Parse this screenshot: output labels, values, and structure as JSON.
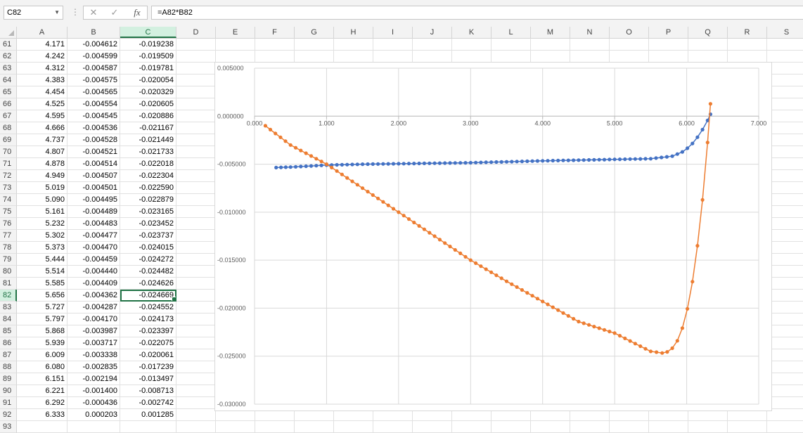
{
  "formula_bar": {
    "name_box": "C82",
    "formula": "=A82*B82",
    "fx_label": "fx",
    "cancel_glyph": "✕",
    "enter_glyph": "✓",
    "dropdown_icon": "chevron-down-icon"
  },
  "columns": [
    "A",
    "B",
    "C",
    "D",
    "E",
    "F",
    "G",
    "H",
    "I",
    "J",
    "K",
    "L",
    "M",
    "N",
    "O",
    "P",
    "Q",
    "R",
    "S"
  ],
  "selected_column": "C",
  "selected_row": "82",
  "rows": [
    {
      "num": "61",
      "a": "4.171",
      "b": "-0.004612",
      "c": "-0.019238"
    },
    {
      "num": "62",
      "a": "4.242",
      "b": "-0.004599",
      "c": "-0.019509"
    },
    {
      "num": "63",
      "a": "4.312",
      "b": "-0.004587",
      "c": "-0.019781"
    },
    {
      "num": "64",
      "a": "4.383",
      "b": "-0.004575",
      "c": "-0.020054"
    },
    {
      "num": "65",
      "a": "4.454",
      "b": "-0.004565",
      "c": "-0.020329"
    },
    {
      "num": "66",
      "a": "4.525",
      "b": "-0.004554",
      "c": "-0.020605"
    },
    {
      "num": "67",
      "a": "4.595",
      "b": "-0.004545",
      "c": "-0.020886"
    },
    {
      "num": "68",
      "a": "4.666",
      "b": "-0.004536",
      "c": "-0.021167"
    },
    {
      "num": "69",
      "a": "4.737",
      "b": "-0.004528",
      "c": "-0.021449"
    },
    {
      "num": "70",
      "a": "4.807",
      "b": "-0.004521",
      "c": "-0.021733"
    },
    {
      "num": "71",
      "a": "4.878",
      "b": "-0.004514",
      "c": "-0.022018"
    },
    {
      "num": "72",
      "a": "4.949",
      "b": "-0.004507",
      "c": "-0.022304"
    },
    {
      "num": "73",
      "a": "5.019",
      "b": "-0.004501",
      "c": "-0.022590"
    },
    {
      "num": "74",
      "a": "5.090",
      "b": "-0.004495",
      "c": "-0.022879"
    },
    {
      "num": "75",
      "a": "5.161",
      "b": "-0.004489",
      "c": "-0.023165"
    },
    {
      "num": "76",
      "a": "5.232",
      "b": "-0.004483",
      "c": "-0.023452"
    },
    {
      "num": "77",
      "a": "5.302",
      "b": "-0.004477",
      "c": "-0.023737"
    },
    {
      "num": "78",
      "a": "5.373",
      "b": "-0.004470",
      "c": "-0.024015"
    },
    {
      "num": "79",
      "a": "5.444",
      "b": "-0.004459",
      "c": "-0.024272"
    },
    {
      "num": "80",
      "a": "5.514",
      "b": "-0.004440",
      "c": "-0.024482"
    },
    {
      "num": "81",
      "a": "5.585",
      "b": "-0.004409",
      "c": "-0.024626"
    },
    {
      "num": "82",
      "a": "5.656",
      "b": "-0.004362",
      "c": "-0.024669"
    },
    {
      "num": "83",
      "a": "5.727",
      "b": "-0.004287",
      "c": "-0.024552"
    },
    {
      "num": "84",
      "a": "5.797",
      "b": "-0.004170",
      "c": "-0.024173"
    },
    {
      "num": "85",
      "a": "5.868",
      "b": "-0.003987",
      "c": "-0.023397"
    },
    {
      "num": "86",
      "a": "5.939",
      "b": "-0.003717",
      "c": "-0.022075"
    },
    {
      "num": "87",
      "a": "6.009",
      "b": "-0.003338",
      "c": "-0.020061"
    },
    {
      "num": "88",
      "a": "6.080",
      "b": "-0.002835",
      "c": "-0.017239"
    },
    {
      "num": "89",
      "a": "6.151",
      "b": "-0.002194",
      "c": "-0.013497"
    },
    {
      "num": "90",
      "a": "6.221",
      "b": "-0.001400",
      "c": "-0.008713"
    },
    {
      "num": "91",
      "a": "6.292",
      "b": "-0.000436",
      "c": "-0.002742"
    },
    {
      "num": "92",
      "a": "6.333",
      "b": "0.000203",
      "c": "0.001285"
    },
    {
      "num": "93",
      "a": "",
      "b": "",
      "c": ""
    }
  ],
  "chart_data": {
    "type": "scatter",
    "y_tick_labels": [
      "0.005000",
      "0.000000",
      "-0.005000",
      "-0.010000",
      "-0.015000",
      "-0.020000",
      "-0.025000",
      "-0.030000"
    ],
    "x_tick_labels": [
      "0.000",
      "1.000",
      "2.000",
      "3.000",
      "4.000",
      "5.000",
      "6.000",
      "7.000"
    ],
    "xlim": [
      0,
      7
    ],
    "ylim": [
      -0.03,
      0.005
    ],
    "grid": true,
    "legend": "none",
    "series": [
      {
        "color": "#4472c4",
        "x": [
          0.3,
          0.5,
          1.0,
          1.5,
          2.0,
          2.5,
          3.0,
          3.5,
          4.0,
          4.5,
          5.0,
          5.5,
          5.8,
          5.94,
          6.01,
          6.08,
          6.15,
          6.22,
          6.29,
          6.33
        ],
        "y": [
          -0.00535,
          -0.0053,
          -0.0051,
          -0.005,
          -0.00495,
          -0.0049,
          -0.00485,
          -0.00475,
          -0.00465,
          -0.00458,
          -0.0045,
          -0.00443,
          -0.00417,
          -0.00372,
          -0.00334,
          -0.00284,
          -0.00219,
          -0.0014,
          -0.00044,
          0.000203
        ]
      },
      {
        "color": "#ed7d31",
        "x": [
          0.15,
          0.5,
          1.0,
          1.5,
          2.0,
          2.5,
          3.0,
          3.5,
          4.0,
          4.5,
          5.0,
          5.5,
          5.66,
          5.73,
          5.8,
          5.87,
          5.94,
          6.01,
          6.08,
          6.15,
          6.22,
          6.29,
          6.33
        ],
        "y": [
          -0.001,
          -0.003,
          -0.005,
          -0.0075,
          -0.01,
          -0.0125,
          -0.015,
          -0.0172,
          -0.0193,
          -0.0214,
          -0.0226,
          -0.0245,
          -0.024669,
          -0.024552,
          -0.024173,
          -0.023397,
          -0.022075,
          -0.020061,
          -0.017239,
          -0.013497,
          -0.008713,
          -0.002742,
          0.001285
        ]
      }
    ]
  }
}
